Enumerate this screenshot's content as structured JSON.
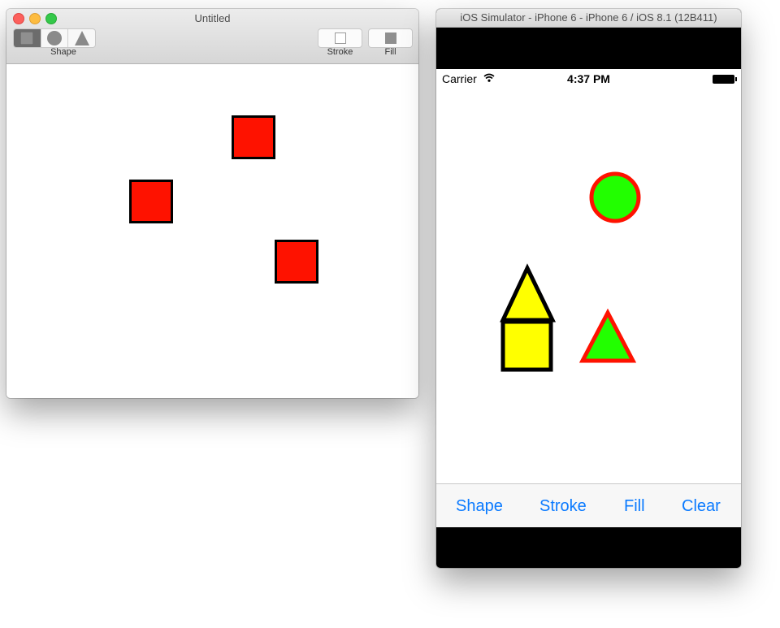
{
  "mac_window": {
    "title": "Untitled",
    "toolbar": {
      "shape_group_label": "Shape",
      "shape_options": [
        "square-icon",
        "circle-icon",
        "triangle-icon"
      ],
      "selected_shape": "square",
      "stroke_label": "Stroke",
      "fill_label": "Fill"
    },
    "canvas": {
      "shapes": [
        {
          "type": "square",
          "fill": "#fe1200",
          "stroke": "#000000"
        },
        {
          "type": "square",
          "fill": "#fe1200",
          "stroke": "#000000"
        },
        {
          "type": "square",
          "fill": "#fe1200",
          "stroke": "#000000"
        }
      ]
    }
  },
  "simulator": {
    "title": "iOS Simulator - iPhone 6 - iPhone 6 / iOS 8.1 (12B411)",
    "status_bar": {
      "carrier": "Carrier",
      "time": "4:37 PM"
    },
    "canvas": {
      "shapes": [
        {
          "type": "circle",
          "fill": "#22ff00",
          "stroke": "#fe1200"
        },
        {
          "type": "triangle",
          "fill": "#ffff00",
          "stroke": "#000000"
        },
        {
          "type": "square",
          "fill": "#ffff00",
          "stroke": "#000000"
        },
        {
          "type": "triangle",
          "fill": "#22ff00",
          "stroke": "#fe1200"
        }
      ]
    },
    "toolbar": {
      "shape_label": "Shape",
      "stroke_label": "Stroke",
      "fill_label": "Fill",
      "clear_label": "Clear"
    },
    "accent_color": "#0a7aff"
  }
}
